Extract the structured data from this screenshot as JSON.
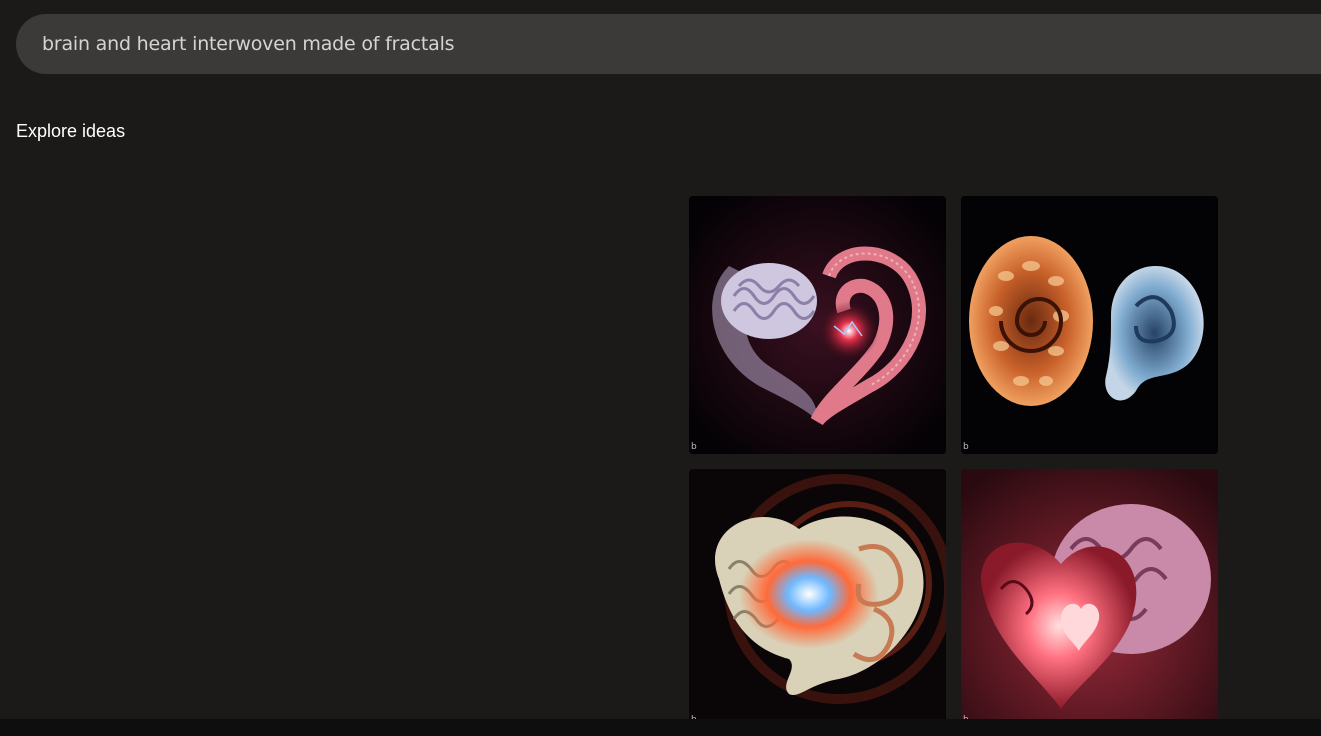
{
  "search": {
    "query": "brain and heart interwoven made of fractals"
  },
  "explore": {
    "title": "Explore ideas"
  },
  "images": [
    {
      "subject": "brain-heart-fractal-1",
      "badge": "b"
    },
    {
      "subject": "brain-heart-fractal-2",
      "badge": "b"
    },
    {
      "subject": "brain-heart-fractal-3",
      "badge": "b"
    },
    {
      "subject": "brain-heart-fractal-4",
      "badge": "b"
    }
  ],
  "colors": {
    "background": "#1b1a19",
    "search_bar": "#3b3a39",
    "search_text": "#d6d4d2",
    "title_text": "#ffffff"
  }
}
